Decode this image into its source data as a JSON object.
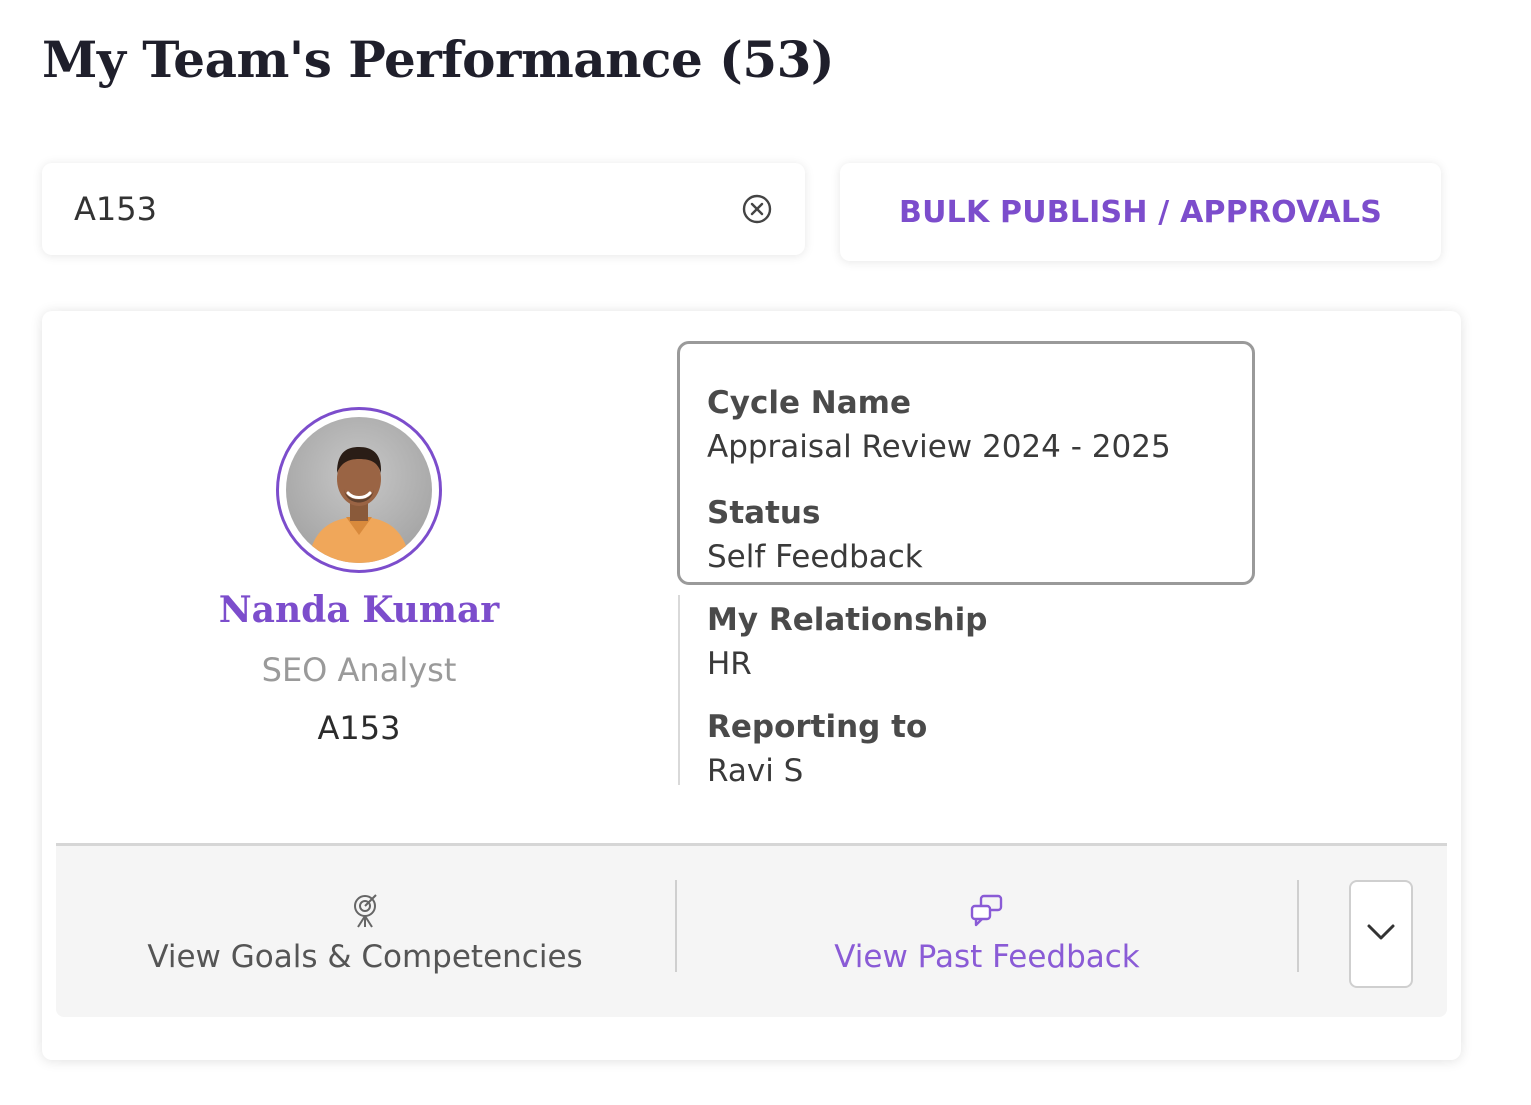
{
  "header": {
    "title": "My Team's Performance (53)"
  },
  "search": {
    "value": "A153",
    "clear_icon": "circle-x-icon"
  },
  "toolbar": {
    "bulk_label": "BULK PUBLISH / APPROVALS"
  },
  "employee": {
    "name": "Nanda Kumar",
    "role": "SEO Analyst",
    "id": "A153",
    "avatar": "profile-photo"
  },
  "details": {
    "cycle_name_label": "Cycle Name",
    "cycle_name_value": "Appraisal Review 2024 - 2025",
    "status_label": "Status",
    "status_value": "Self Feedback",
    "relationship_label": "My Relationship",
    "relationship_value": "HR",
    "reporting_label": "Reporting to",
    "reporting_value": "Ravi S"
  },
  "actions": {
    "goals_label": "View Goals & Competencies",
    "goals_icon": "target-icon",
    "past_feedback_label": "View Past Feedback",
    "past_feedback_icon": "chat-icon",
    "expand_icon": "chevron-down-icon"
  },
  "colors": {
    "accent": "#7c4dcc",
    "text": "#2b2b2b",
    "muted": "#9a9a9a"
  }
}
